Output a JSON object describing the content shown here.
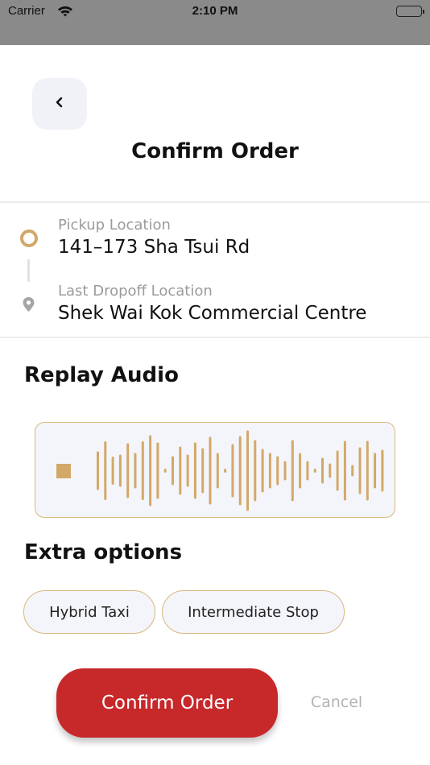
{
  "status_bar": {
    "carrier": "Carrier",
    "time": "2:10 PM",
    "icons": [
      "wifi-icon",
      "battery-icon"
    ]
  },
  "header": {
    "back_icon": "chevron-left-icon",
    "title": "Confirm Order"
  },
  "route": {
    "pickup_label": "Pickup Location",
    "pickup_value": "141–173 Sha Tsui Rd",
    "dropoff_label": "Last Dropoff Location",
    "dropoff_value": "Shek Wai Kok Commercial Centre",
    "pickup_icon": "origin-ring-icon",
    "dropoff_icon": "location-pin-icon"
  },
  "audio": {
    "title": "Replay Audio",
    "control_icon": "stop-icon",
    "waveform_levels": [
      0.48,
      0.73,
      0.35,
      0.4,
      0.68,
      0.44,
      0.73,
      0.88,
      0.7,
      0.05,
      0.36,
      0.6,
      0.4,
      0.7,
      0.56,
      0.84,
      0.44,
      0.05,
      0.66,
      0.86,
      1.0,
      0.76,
      0.54,
      0.44,
      0.36,
      0.24,
      0.76,
      0.44,
      0.24,
      0.05,
      0.32,
      0.18,
      0.5,
      0.74,
      0.14,
      0.58,
      0.74,
      0.44,
      0.52
    ]
  },
  "extra_options": {
    "title": "Extra options",
    "chips": [
      "Hybrid Taxi",
      "Intermediate Stop"
    ]
  },
  "actions": {
    "confirm_label": "Confirm Order",
    "cancel_label": "Cancel"
  },
  "colors": {
    "accent_gold": "#d2a869",
    "confirm_red": "#c7282a",
    "chip_background": "#f4f5fa",
    "status_bar": "#8a8a8a"
  }
}
